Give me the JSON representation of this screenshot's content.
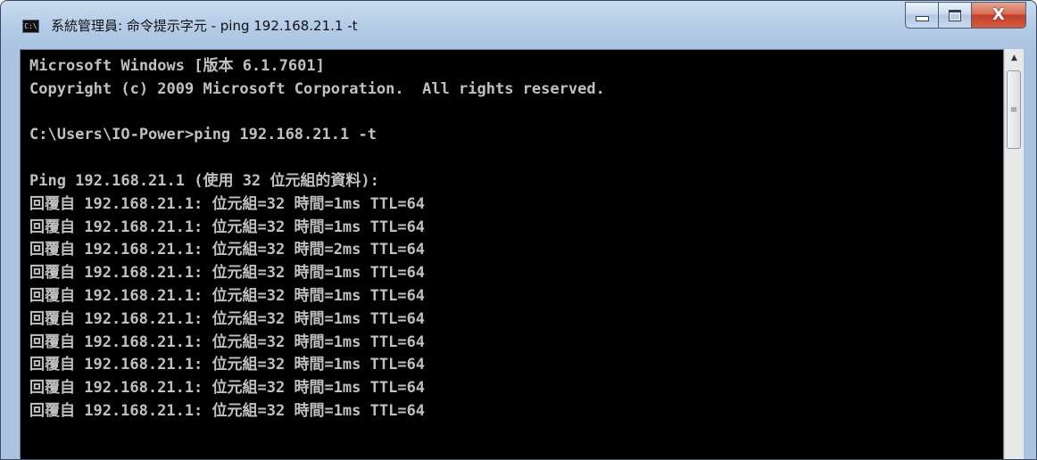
{
  "window": {
    "title": "系統管理員: 命令提示字元 - ping 192.168.21.1 -t",
    "icon": "cmd-icon",
    "icon_text": "C:\\"
  },
  "caption_buttons": {
    "minimize": "minimize-icon",
    "maximize": "maximize-icon",
    "close": "close-icon",
    "close_glyph": "X"
  },
  "console": {
    "lines": [
      "Microsoft Windows [版本 6.1.7601]",
      "Copyright (c) 2009 Microsoft Corporation.  All rights reserved.",
      "",
      "C:\\Users\\IO-Power>ping 192.168.21.1 -t",
      "",
      "Ping 192.168.21.1 (使用 32 位元組的資料):",
      "回覆自 192.168.21.1: 位元組=32 時間=1ms TTL=64",
      "回覆自 192.168.21.1: 位元組=32 時間=1ms TTL=64",
      "回覆自 192.168.21.1: 位元組=32 時間=2ms TTL=64",
      "回覆自 192.168.21.1: 位元組=32 時間=1ms TTL=64",
      "回覆自 192.168.21.1: 位元組=32 時間=1ms TTL=64",
      "回覆自 192.168.21.1: 位元組=32 時間=1ms TTL=64",
      "回覆自 192.168.21.1: 位元組=32 時間=1ms TTL=64",
      "回覆自 192.168.21.1: 位元組=32 時間=1ms TTL=64",
      "回覆自 192.168.21.1: 位元組=32 時間=1ms TTL=64",
      "回覆自 192.168.21.1: 位元組=32 時間=1ms TTL=64"
    ],
    "colors": {
      "background": "#000000",
      "text": "#c0c0c0"
    }
  },
  "scrollbar": {
    "up_arrow": "scroll-up-arrow-icon",
    "thumb_grip": "grip-icon"
  }
}
